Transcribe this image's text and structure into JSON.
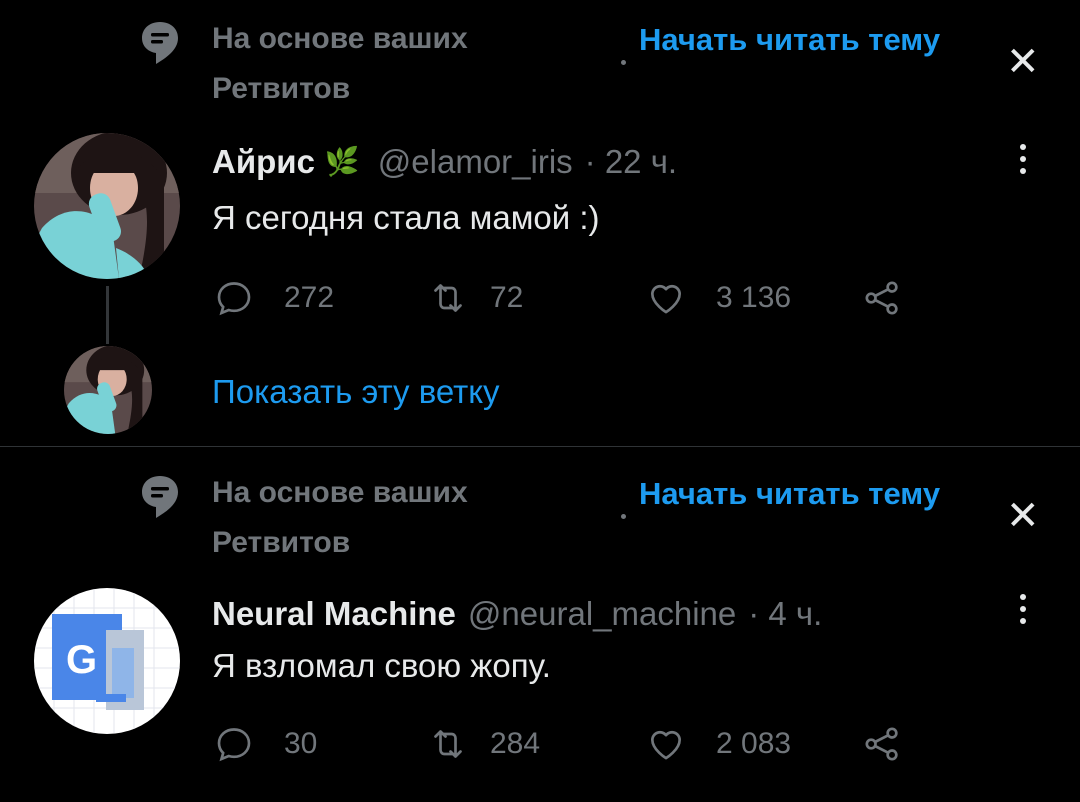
{
  "block1": {
    "context_text": "На основе ваших Ретвитов",
    "start_reading": "Начать читать тему",
    "close_glyph": "✕",
    "tweet": {
      "display_name": "Айрис",
      "emoji": "🌿",
      "handle": "@elamor_iris",
      "time": "· 22 ч.",
      "text": "Я сегодня стала мамой :)",
      "replies": "272",
      "retweets": "72",
      "likes": "3 136"
    },
    "show_thread": "Показать эту ветку"
  },
  "block2": {
    "context_text": "На основе ваших Ретвитов",
    "start_reading": "Начать читать тему",
    "close_glyph": "✕",
    "tweet": {
      "display_name": "Neural Machine",
      "handle": "@neural_machine",
      "time": "· 4 ч.",
      "text": "Я взломал свою жопу.",
      "replies": "30",
      "retweets": "284",
      "likes": "2 083"
    }
  },
  "icons": {
    "context": "topic-bubble-icon",
    "reply": "reply-icon",
    "retweet": "retweet-icon",
    "like": "heart-icon",
    "share": "share-icon",
    "more": "more-icon"
  },
  "colors": {
    "background": "#000000",
    "text": "#e7e9ea",
    "muted": "#71767b",
    "accent": "#1d9bf0"
  }
}
